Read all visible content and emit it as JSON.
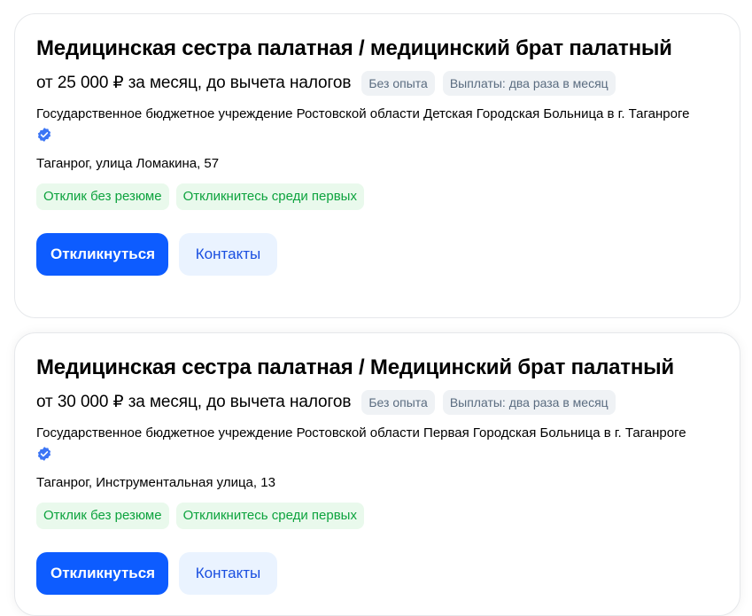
{
  "vacancies": [
    {
      "title": "Медицинская сестра палатная / медицинский брат палатный",
      "salary": "от 25 000 ₽ за месяц, до вычета налогов",
      "tags": [
        "Без опыта",
        "Выплаты: два раза в месяц"
      ],
      "company": "Государственное бюджетное учреждение Ростовской области Детская Городская Больница в г. Таганроге",
      "verified_icon": "verified-check-icon",
      "address": "Таганрог, улица Ломакина, 57",
      "badges": [
        "Отклик без резюме",
        "Откликнитесь среди первых"
      ],
      "apply_label": "Откликнуться",
      "contacts_label": "Контакты"
    },
    {
      "title": "Медицинская сестра палатная / Медицинский брат палатный",
      "salary": "от 30 000 ₽ за месяц, до вычета налогов",
      "tags": [
        "Без опыта",
        "Выплаты: два раза в месяц"
      ],
      "company": "Государственное бюджетное учреждение Ростовской области Первая Городская Больница в г. Таганроге",
      "verified_icon": "verified-check-icon",
      "address": "Таганрог, Инструментальная улица, 13",
      "badges": [
        "Отклик без резюме",
        "Откликнитесь среди первых"
      ],
      "apply_label": "Откликнуться",
      "contacts_label": "Контакты"
    }
  ],
  "colors": {
    "primary": "#0d5cff",
    "secondary_bg": "#eaf3ff",
    "tag_bg": "#eff2f5",
    "green_bg": "#e9f9ec",
    "green_text": "#0da33e",
    "verified": "#3b75f5"
  }
}
